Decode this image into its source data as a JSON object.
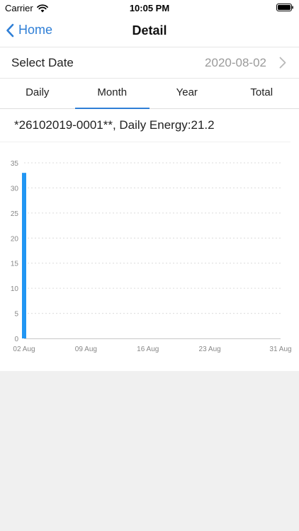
{
  "status_bar": {
    "carrier": "Carrier",
    "time": "10:05 PM"
  },
  "nav": {
    "back_label": "Home",
    "title": "Detail"
  },
  "date_picker": {
    "label": "Select Date",
    "value": "2020-08-02"
  },
  "tabs": [
    {
      "label": "Daily",
      "active": false
    },
    {
      "label": "Month",
      "active": true
    },
    {
      "label": "Year",
      "active": false
    },
    {
      "label": "Total",
      "active": false
    }
  ],
  "info": {
    "text": "*26102019-0001**, Daily Energy:21.2"
  },
  "colors": {
    "accent": "#2f7fd6",
    "bar": "#2196f3",
    "grid": "#dcdcdc",
    "axis_text": "#888888"
  },
  "chart_data": {
    "type": "bar",
    "categories": [
      "02 Aug"
    ],
    "values": [
      33
    ],
    "x_ticks": [
      "02 Aug",
      "09 Aug",
      "16 Aug",
      "23 Aug",
      "31 Aug"
    ],
    "y_ticks": [
      0,
      5,
      10,
      15,
      20,
      25,
      30,
      35
    ],
    "ylim": [
      0,
      35
    ],
    "grid": true,
    "title": "",
    "xlabel": "",
    "ylabel": ""
  }
}
